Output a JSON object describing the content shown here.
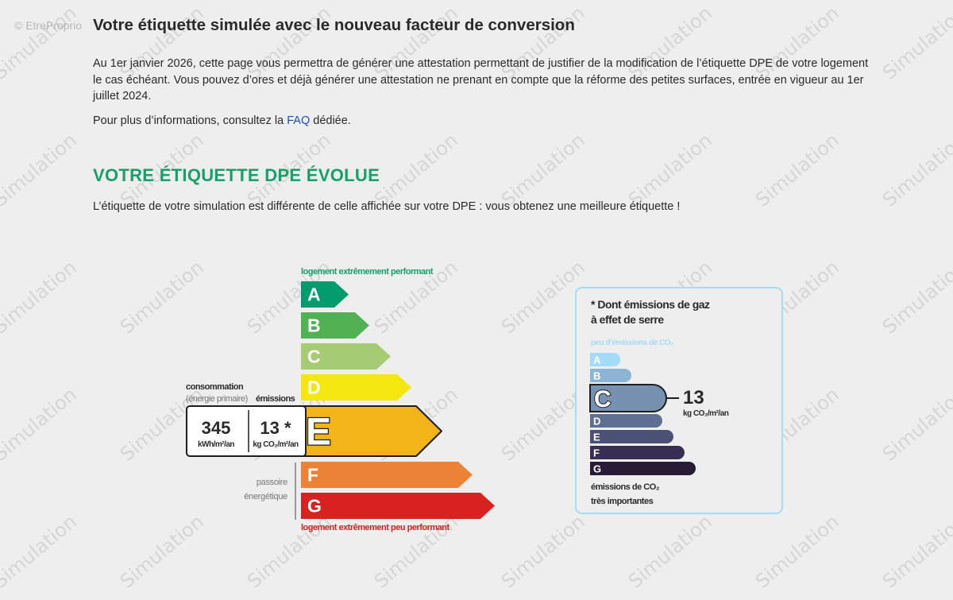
{
  "copyright": "© EtreProprio",
  "watermark_text": "Simulation",
  "header": {
    "title": "Votre étiquette simulée avec le nouveau facteur de conversion"
  },
  "intro": {
    "paragraph": "Au 1er janvier 2026, cette page vous permettra de générer une attestation permettant de justifier de la modification de l’étiquette DPE de votre logement le cas échéant. Vous pouvez d’ores et déjà générer une attestation ne prenant en compte que la réforme des petites surfaces, entrée en vigueur au 1er juillet 2024.",
    "more_prefix": "Pour plus d’informations, consultez la ",
    "faq_link": "FAQ",
    "more_suffix": " dédiée."
  },
  "dpe": {
    "heading": "VOTRE ÉTIQUETTE DPE ÉVOLUE",
    "description": "L’étiquette de votre simulation est différente de celle affichée sur votre DPE : vous obtenez une meilleure étiquette !",
    "top_label": "logement extrêmement performant",
    "bottom_label": "logement extrêmement peu performant",
    "classes": [
      {
        "letter": "A",
        "color": "#009c6d"
      },
      {
        "letter": "B",
        "color": "#52b153"
      },
      {
        "letter": "C",
        "color": "#a5cc74"
      },
      {
        "letter": "D",
        "color": "#f4e70f"
      },
      {
        "letter": "E",
        "color": "#f2b419"
      },
      {
        "letter": "F",
        "color": "#eb8235"
      },
      {
        "letter": "G",
        "color": "#d7221f"
      }
    ],
    "current_class": "E",
    "consumption_label": "consommation",
    "consumption_sublabel": "(énergie primaire)",
    "emissions_label": "émissions",
    "consumption_value": "345",
    "consumption_unit": "kWh/m²/an",
    "emissions_value": "13 *",
    "emissions_unit": "kg CO₂/m²/an",
    "passoire_label_1": "passoire",
    "passoire_label_2": "énergétique"
  },
  "ges": {
    "title_line1": "* Dont émissions de gaz",
    "title_line2": "à effet de serre",
    "top_label": "peu d’émissions de CO₂",
    "bottom_label_1": "émissions de CO₂",
    "bottom_label_2": "très importantes",
    "current_class": "C",
    "value": "13",
    "unit": "kg CO₂/m²/an",
    "classes": [
      {
        "letter": "A",
        "color": "#a4dbf8"
      },
      {
        "letter": "B",
        "color": "#8cb4d3"
      },
      {
        "letter": "C",
        "color": "#7792b1"
      },
      {
        "letter": "D",
        "color": "#5f6f93"
      },
      {
        "letter": "E",
        "color": "#4b5174"
      },
      {
        "letter": "F",
        "color": "#372f53"
      },
      {
        "letter": "G",
        "color": "#281b35"
      }
    ]
  }
}
